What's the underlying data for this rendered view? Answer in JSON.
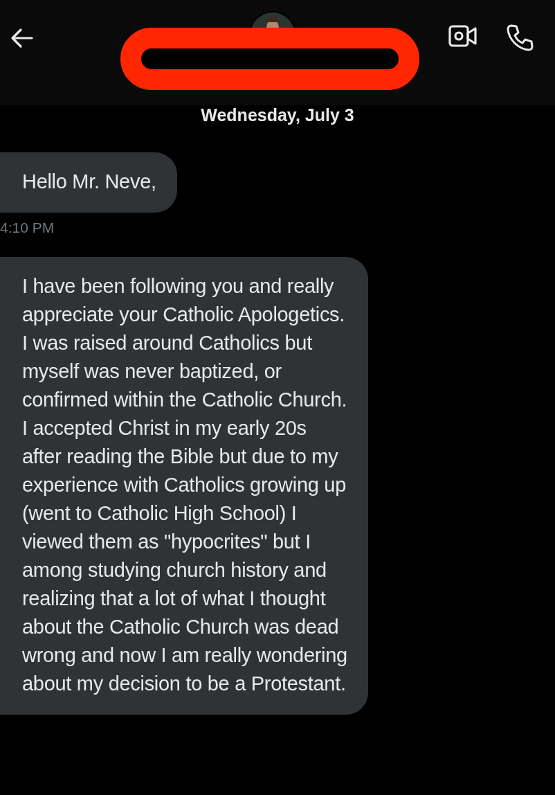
{
  "date_divider": "Wednesday, July 3",
  "messages": [
    {
      "text": "Hello Mr. Neve,",
      "time": "4:10 PM"
    },
    {
      "text": "I have been following you and really appreciate your Catholic Apologetics. I was raised around Catholics but myself was never baptized, or confirmed within the Catholic Church. I accepted Christ in my early 20s after reading the Bible but due to my experience with Catholics growing up (went to Catholic High School) I viewed them as \"hypocrites\" but I among studying church history and realizing that a lot of what I thought about the Catholic Church was dead wrong and now I am really wondering about my decision to be a Protestant."
    }
  ]
}
